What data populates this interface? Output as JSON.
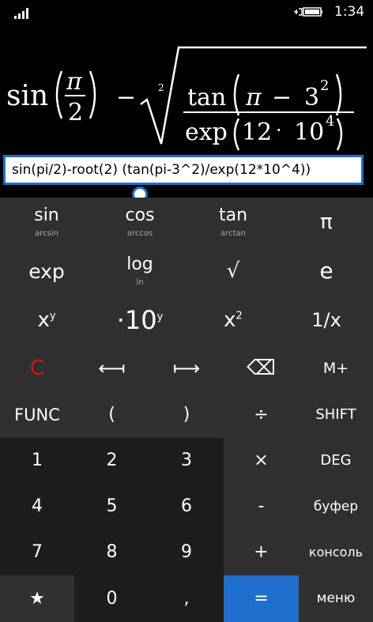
{
  "status": {
    "time": "1:34"
  },
  "formula_display": {
    "sin": "sin",
    "pi": "π",
    "two": "2",
    "minus": "−",
    "root_index": "2",
    "tan": "tan",
    "pi2": "π",
    "minus2": "−",
    "three": "3",
    "sq": "2",
    "exp": "exp",
    "twelve": "12",
    "dot": "·",
    "ten": "10",
    "four": "4"
  },
  "input": {
    "value": "sin(pi/2)-root(2) (tan(pi-3^2)/exp(12*10^4))"
  },
  "keys": {
    "sin": {
      "label": "sin",
      "sub": "arcsin"
    },
    "cos": {
      "label": "cos",
      "sub": "arccos"
    },
    "tan": {
      "label": "tan",
      "sub": "arctan"
    },
    "pi": {
      "label": "π"
    },
    "exp": {
      "label": "exp"
    },
    "log": {
      "label": "log",
      "sub": "ln"
    },
    "sqrt": {
      "label": "√"
    },
    "e": {
      "label": "e"
    },
    "xpow": {
      "base": "x",
      "sup": "y"
    },
    "tenpow": {
      "base": "·10",
      "sup": "y"
    },
    "xsq": {
      "base": "x",
      "sup": "2"
    },
    "inv": {
      "label": "1/x"
    },
    "clear": {
      "label": "C"
    },
    "left": {
      "label": "⟻"
    },
    "right": {
      "label": "⟼"
    },
    "backspace": {
      "label": "⌫"
    },
    "mplus": {
      "label": "M+"
    },
    "func": {
      "label": "FUNC"
    },
    "lparen": {
      "label": "("
    },
    "rparen": {
      "label": ")"
    },
    "divide": {
      "label": "÷"
    },
    "shift": {
      "label": "SHIFT"
    },
    "n1": {
      "label": "1"
    },
    "n2": {
      "label": "2"
    },
    "n3": {
      "label": "3"
    },
    "multiply": {
      "label": "×"
    },
    "deg": {
      "label": "DEG"
    },
    "n4": {
      "label": "4"
    },
    "n5": {
      "label": "5"
    },
    "n6": {
      "label": "6"
    },
    "minus": {
      "label": "-"
    },
    "buffer": {
      "label": "буфер"
    },
    "n7": {
      "label": "7"
    },
    "n8": {
      "label": "8"
    },
    "n9": {
      "label": "9"
    },
    "plus": {
      "label": "+"
    },
    "console": {
      "label": "консоль"
    },
    "star": {
      "label": "★"
    },
    "n0": {
      "label": "0"
    },
    "comma": {
      "label": ","
    },
    "equals": {
      "label": "="
    },
    "menu": {
      "label": "меню"
    }
  },
  "colors": {
    "accent": "#1f6fcf",
    "clear": "#e01010"
  },
  "icons": [
    "signal-icon",
    "battery-icon",
    "backspace-icon",
    "star-icon"
  ]
}
